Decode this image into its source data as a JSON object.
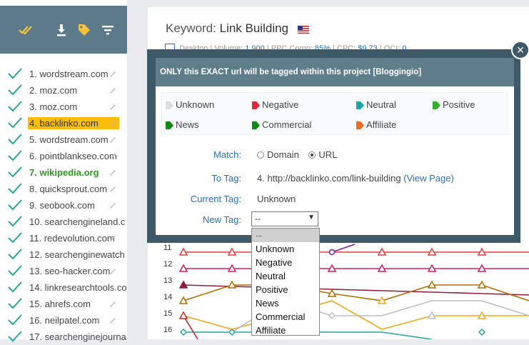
{
  "sidebar": {
    "toolbar_icons": [
      "double-check-icon",
      "download-icon",
      "tag-icon",
      "filter-icon"
    ],
    "items": [
      {
        "label": "1. wordstream.com"
      },
      {
        "label": "2. moz.com"
      },
      {
        "label": "3. moz.com"
      },
      {
        "label": "4. backlinko.com"
      },
      {
        "label": "5. wordstream.com"
      },
      {
        "label": "6. pointblankseo.com"
      },
      {
        "label": "7. wikipedia.org"
      },
      {
        "label": "8. quicksprout.com"
      },
      {
        "label": "9. seobook.com"
      },
      {
        "label": "10. searchengineland.c"
      },
      {
        "label": "11. redevolution.com"
      },
      {
        "label": "12. searchenginewatch"
      },
      {
        "label": "13. seo-hacker.com"
      },
      {
        "label": "14. linkresearchtools.co"
      },
      {
        "label": "15. ahrefs.com"
      },
      {
        "label": "16. neilpatel.com"
      },
      {
        "label": "17. searchenginejourna"
      }
    ]
  },
  "header": {
    "keyword_label": "Keyword:",
    "keyword_value": "Link Building",
    "stats_device": "Desktop",
    "stats_volume_label": "| Volume:",
    "stats_volume": "1,900",
    "stats_comp_label": "| PPC Comp:",
    "stats_comp": "85%",
    "stats_cpc_label": "| CPC:",
    "stats_cpc": "$9.73",
    "stats_oci_label": "| OCI:",
    "stats_oci": "0"
  },
  "modal": {
    "title": "ONLY this EXACT url will be tagged within this project [Bloggingio]",
    "tags": [
      {
        "label": "Unknown",
        "color": "#dddddd"
      },
      {
        "label": "Negative",
        "color": "#e0283a"
      },
      {
        "label": "Neutral",
        "color": "#1fa3a6"
      },
      {
        "label": "Positive",
        "color": "#31b02c"
      },
      {
        "label": "News",
        "color": "#0f8a13"
      },
      {
        "label": "Commercial",
        "color": "#0f8a13"
      },
      {
        "label": "Affiliate",
        "color": "#f06b1e"
      }
    ],
    "match_label": "Match:",
    "match_options": [
      "Domain",
      "URL"
    ],
    "match_selected": "URL",
    "to_tag_label": "To Tag:",
    "to_tag_value": "4. http://backlinko.com/link-building",
    "view_page_link": "(View Page)",
    "current_tag_label": "Current Tag:",
    "current_tag_value": "Unknown",
    "new_tag_label": "New Tag:",
    "new_tag_selected": "--",
    "close_glyph": "×"
  },
  "dropdown": {
    "options": [
      "--",
      "Unknown",
      "Negative",
      "Neutral",
      "Positive",
      "News",
      "Commercial",
      "Affiliate"
    ]
  },
  "chart_data": {
    "type": "line",
    "y_tick_labels": [
      "11",
      "12",
      "13",
      "14",
      "15",
      "16"
    ],
    "ylim": [
      10.3,
      16.6
    ]
  }
}
